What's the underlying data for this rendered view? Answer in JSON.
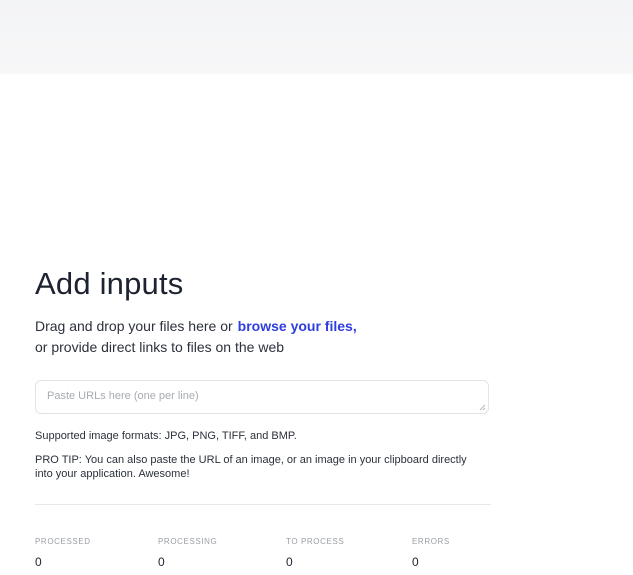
{
  "header": {
    "title": "Add inputs",
    "description_line1": "Drag and drop your files here or",
    "browse_link": "browse your files,",
    "description_line2": "or provide direct links to files on the web"
  },
  "url_input": {
    "placeholder": "Paste URLs here (one per line)",
    "value": ""
  },
  "info": {
    "formats": "Supported image formats: JPG, PNG, TIFF, and BMP.",
    "protip": "PRO TIP: You can also paste the URL of an image, or an image in your clipboard directly into your application. Awesome!"
  },
  "stats": [
    {
      "label": "PROCESSED",
      "value": "0"
    },
    {
      "label": "PROCESSING",
      "value": "0"
    },
    {
      "label": "TO PROCESS",
      "value": "0"
    },
    {
      "label": "ERRORS",
      "value": "0"
    }
  ],
  "colors": {
    "link": "#2e3ee0",
    "text": "#1d2230",
    "muted": "#9a9ea6",
    "top_bar": "#f3f4f6"
  }
}
